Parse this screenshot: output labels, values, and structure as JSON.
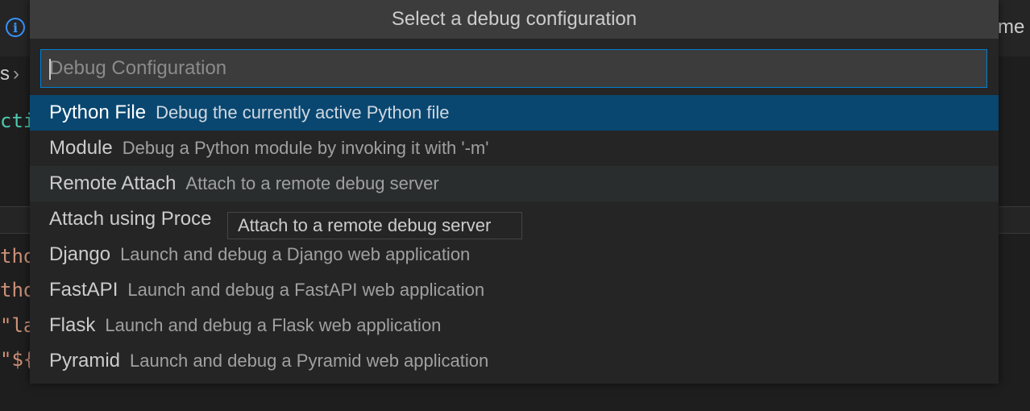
{
  "background": {
    "right_fragment": "me",
    "breadcrumb_fragment": "s",
    "code_lines": [
      {
        "text": "ctio",
        "color": "#4ec9b0"
      },
      {
        "text": "tho",
        "color": "#ce9178"
      },
      {
        "text": "tho",
        "color": "#ce9178"
      },
      {
        "text": "\"la",
        "color": "#ce9178"
      },
      {
        "text": "\"${",
        "color": "#ce9178"
      }
    ]
  },
  "quick_pick": {
    "title": "Select a debug configuration",
    "input": {
      "value": "",
      "placeholder": "Debug Configuration"
    },
    "items": [
      {
        "label": "Python File",
        "description": "Debug the currently active Python file",
        "state": "selected"
      },
      {
        "label": "Module",
        "description": "Debug a Python module by invoking it with '-m'",
        "state": "normal"
      },
      {
        "label": "Remote Attach",
        "description": "Attach to a remote debug server",
        "state": "hover"
      },
      {
        "label": "Attach using Proce",
        "description": "",
        "state": "normal"
      },
      {
        "label": "Django",
        "description": "Launch and debug a Django web application",
        "state": "normal"
      },
      {
        "label": "FastAPI",
        "description": "Launch and debug a FastAPI web application",
        "state": "normal"
      },
      {
        "label": "Flask",
        "description": "Launch and debug a Flask web application",
        "state": "normal"
      },
      {
        "label": "Pyramid",
        "description": "Launch and debug a Pyramid web application",
        "state": "normal"
      }
    ]
  },
  "tooltip": {
    "text": "Attach to a remote debug server"
  },
  "colors": {
    "accent": "#007fd4",
    "selected_row": "#094771",
    "info_icon": "#3794ff"
  }
}
